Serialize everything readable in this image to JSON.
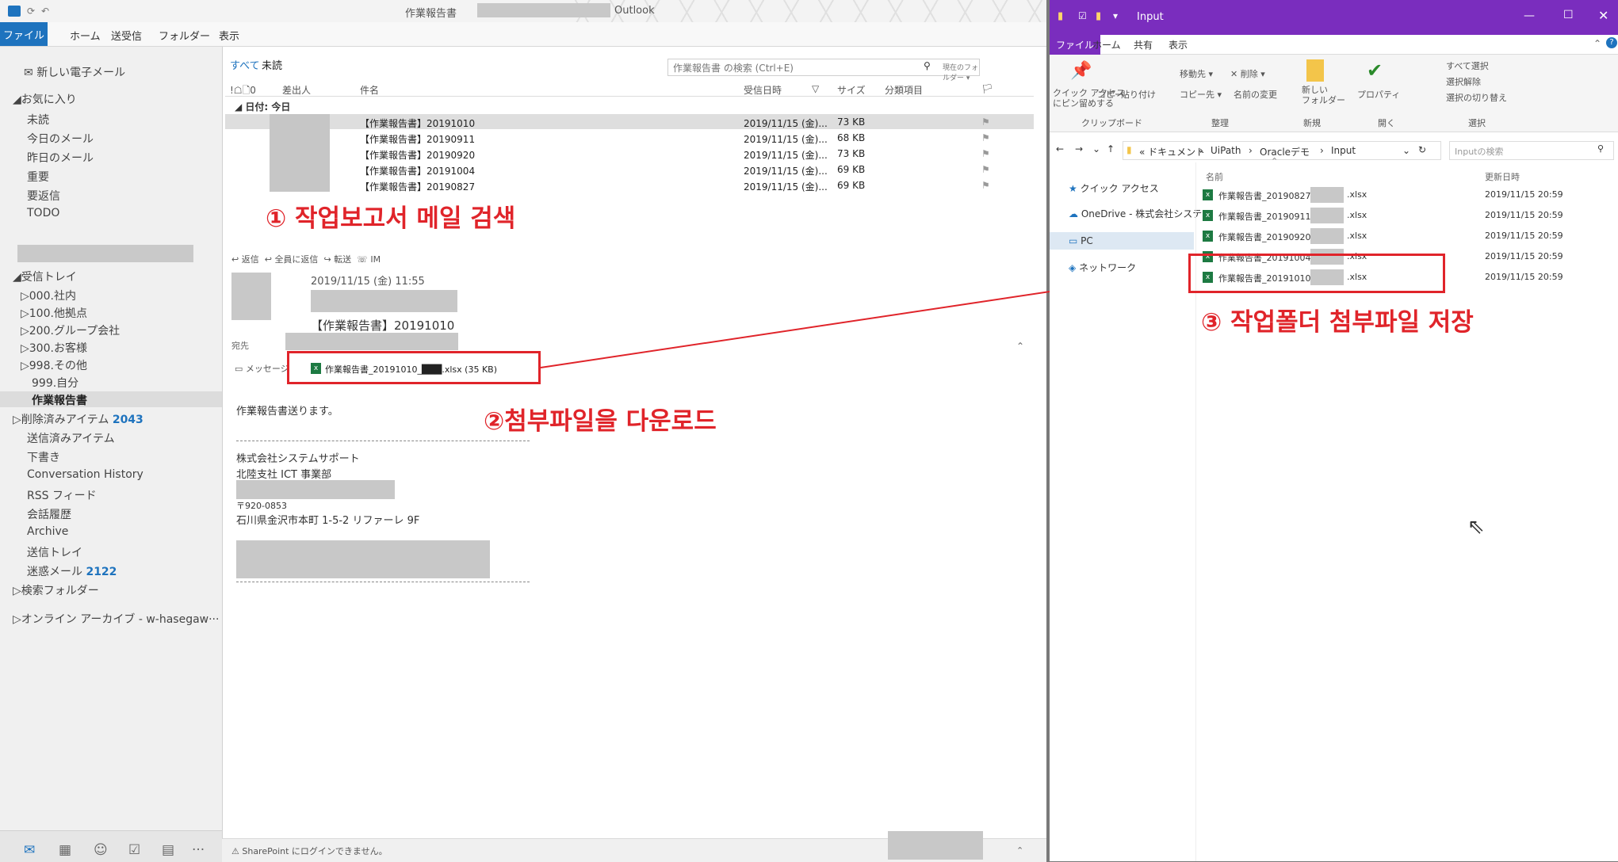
{
  "outlook": {
    "title": "作業報告書",
    "app_name": "Outlook",
    "menu": [
      "ファイル",
      "ホーム",
      "送受信",
      "フォルダー",
      "表示"
    ],
    "nav": {
      "new_mail": "新しい電子メール",
      "favorites": "◢お気に入り",
      "fav_items": [
        "未読",
        "今日のメール",
        "昨日のメール",
        "重要",
        "要返信",
        "TODO"
      ],
      "inbox": "◢受信トレイ",
      "inbox_items": [
        "▷000.社内",
        "▷100.他拠点",
        "▷200.グループ会社",
        "▷300.お客様",
        "▷998.その他",
        "999.自分"
      ],
      "current_folder": "作業報告書",
      "deleted_label": "▷削除済みアイテム",
      "deleted_count": "2043",
      "other_items": [
        "送信済みアイテム",
        "下書き",
        "Conversation History",
        "RSS フィード",
        "会話履歴",
        "Archive",
        "送信トレイ"
      ],
      "junk_label": "迷惑メール",
      "junk_count": "2122",
      "search_folders": "▷検索フォルダー",
      "online_archive": "▷オンライン アーカイブ - w-hasegaw···"
    },
    "list": {
      "filter_all": "すべて",
      "filter_unread": "未読",
      "search_placeholder": "作業報告書 の検索 (Ctrl+E)",
      "search_scope": "現在のフォルダー ▾",
      "headers": {
        "icons": "!☖🗋0",
        "from": "差出人",
        "subject": "件名",
        "received": "受信日時",
        "sort": "▽",
        "size": "サイズ",
        "category": "分類項目",
        "flag": "🏳"
      },
      "group": "◢ 日付: 今日",
      "rows": [
        {
          "subject": "【作業報告書】20191010",
          "received": "2019/11/15 (金)...",
          "size": "73 KB"
        },
        {
          "subject": "【作業報告書】20190911",
          "received": "2019/11/15 (金)...",
          "size": "68 KB"
        },
        {
          "subject": "【作業報告書】20190920",
          "received": "2019/11/15 (金)...",
          "size": "73 KB"
        },
        {
          "subject": "【作業報告書】20191004",
          "received": "2019/11/15 (金)...",
          "size": "69 KB"
        },
        {
          "subject": "【作業報告書】20190827",
          "received": "2019/11/15 (金)...",
          "size": "69 KB"
        }
      ]
    },
    "reading": {
      "actions": [
        "返信",
        "全員に返信",
        "転送",
        "IM"
      ],
      "date": "2019/11/15 (金) 11:55",
      "subject": "【作業報告書】20191010",
      "to_label": "宛先",
      "message_tab": "メッセージ",
      "attachment": "作業報告書_20191010_███.xlsx (35 KB)",
      "body": [
        "作業報告書送ります。",
        "株式会社システムサポート",
        "北陸支社 ICT 事業部",
        "〒920-0853",
        "石川県金沢市本町 1-5-2 リファーレ 9F"
      ]
    },
    "status": "SharePoint にログインできません。"
  },
  "annotations": {
    "step1": "① 작업보고서 메일 검색",
    "step2": "②첨부파일을 다운로드",
    "step3": "③ 작업폴더 첨부파일 저장"
  },
  "explorer": {
    "title": "Input",
    "tabs": [
      "ファイル",
      "ホーム",
      "共有",
      "表示"
    ],
    "ribbon": {
      "pin": "クイック アクセス\nにピン留めする",
      "copy": "コピー",
      "paste": "貼り付け",
      "move_to": "移動先 ▾",
      "delete": "✕ 削除 ▾",
      "copy_to": "コピー先 ▾",
      "rename": "名前の変更",
      "new_folder": "新しい\nフォルダー",
      "properties": "プロパティ",
      "select_all": "すべて選択",
      "select_none": "選択解除",
      "invert": "選択の切り替え",
      "groups": [
        "クリップボード",
        "整理",
        "新規",
        "開く",
        "選択"
      ]
    },
    "path": [
      "« ドキュメント",
      "UiPath",
      "Oracleデモ",
      "Input"
    ],
    "search_placeholder": "Inputの検索",
    "nav": [
      "クイック アクセス",
      "OneDrive - 株式会社システ",
      "PC",
      "ネットワーク"
    ],
    "columns": {
      "name": "名前",
      "modified": "更新日時"
    },
    "files": [
      {
        "name": "作業報告書_20190827_",
        "ext": ".xlsx",
        "date": "2019/11/15 20:59"
      },
      {
        "name": "作業報告書_20190911_",
        "ext": ".xlsx",
        "date": "2019/11/15 20:59"
      },
      {
        "name": "作業報告書_20190920_",
        "ext": ".xlsx",
        "date": "2019/11/15 20:59"
      },
      {
        "name": "作業報告書_20191004_",
        "ext": ".xlsx",
        "date": "2019/11/15 20:59"
      },
      {
        "name": "作業報告書_20191010_",
        "ext": ".xlsx",
        "date": "2019/11/15 20:59"
      }
    ]
  },
  "colors": {
    "accent_outlook": "#1e73be",
    "accent_explorer": "#7a2dbe",
    "annotation": "#e0242a"
  }
}
